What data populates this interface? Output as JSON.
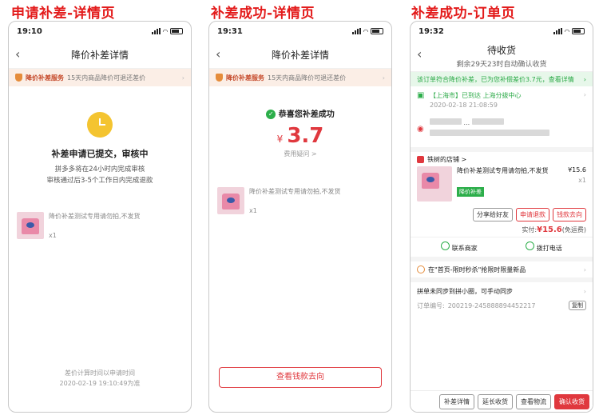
{
  "captions": [
    "申请补差-详情页",
    "补差成功-详情页",
    "补差成功-订单页"
  ],
  "phone1": {
    "time": "19:10",
    "nav_title": "降价补差详情",
    "banner_title": "降价补差服务",
    "banner_desc": "15天内商品降价可退还差价",
    "status_title": "补差申请已提交，审核中",
    "status_line1": "拼多多将在24小时内完成审核",
    "status_line2": "审核通过后3-5个工作日内完成退款",
    "product_name": "降价补差测试专用请勿拍,不发货",
    "qty": "x1",
    "footer_line1": "差价计算时间以申请时间",
    "footer_line2": "2020-02-19 19:10:49为准"
  },
  "phone2": {
    "time": "19:31",
    "nav_title": "降价补差详情",
    "banner_title": "降价补差服务",
    "banner_desc": "15天内商品降价可退还差价",
    "success_text": "恭喜您补差成功",
    "currency": "¥",
    "amount": "3.7",
    "fee_link": "费用疑问 >",
    "product_name": "降价补差测试专用请勿拍,不发货",
    "qty": "x1",
    "bottom_button": "查看钱款去向"
  },
  "phone3": {
    "time": "19:32",
    "nav_title": "待收货",
    "nav_sub": "剩余29天23时自动确认收货",
    "green_bar": "该订单符合降价补差，已为您补偿差价3.7元，查看详情",
    "logistics_text": "【上海市】已到达 上海分拨中心",
    "logistics_time": "2020-02-18 21:08:59",
    "address_partial": "...",
    "store_name": "铁树的店铺 >",
    "product_name": "降价补差测试专用请勿拍,不发货",
    "price": "¥15.6",
    "qty": "x1",
    "tag": "降价补差",
    "btn_share": "分享给好友",
    "btn_refund": "申请退款",
    "btn_money": "钱款去向",
    "paid_label": "实付:",
    "paid_amount": "¥15.6",
    "paid_note": "(免运费)",
    "contact_seller": "联系商家",
    "call": "拨打电话",
    "promo": "在\"首页-限时秒杀\"抢限时限量新品",
    "group_note": "拼单未同步到拼小圈，可手动同步",
    "order_no_label": "订单编号:",
    "order_no": "200219-245888894452217",
    "copy": "复制",
    "footer_btns": [
      "补差详情",
      "延长收货",
      "查看物流",
      "确认收货"
    ]
  }
}
